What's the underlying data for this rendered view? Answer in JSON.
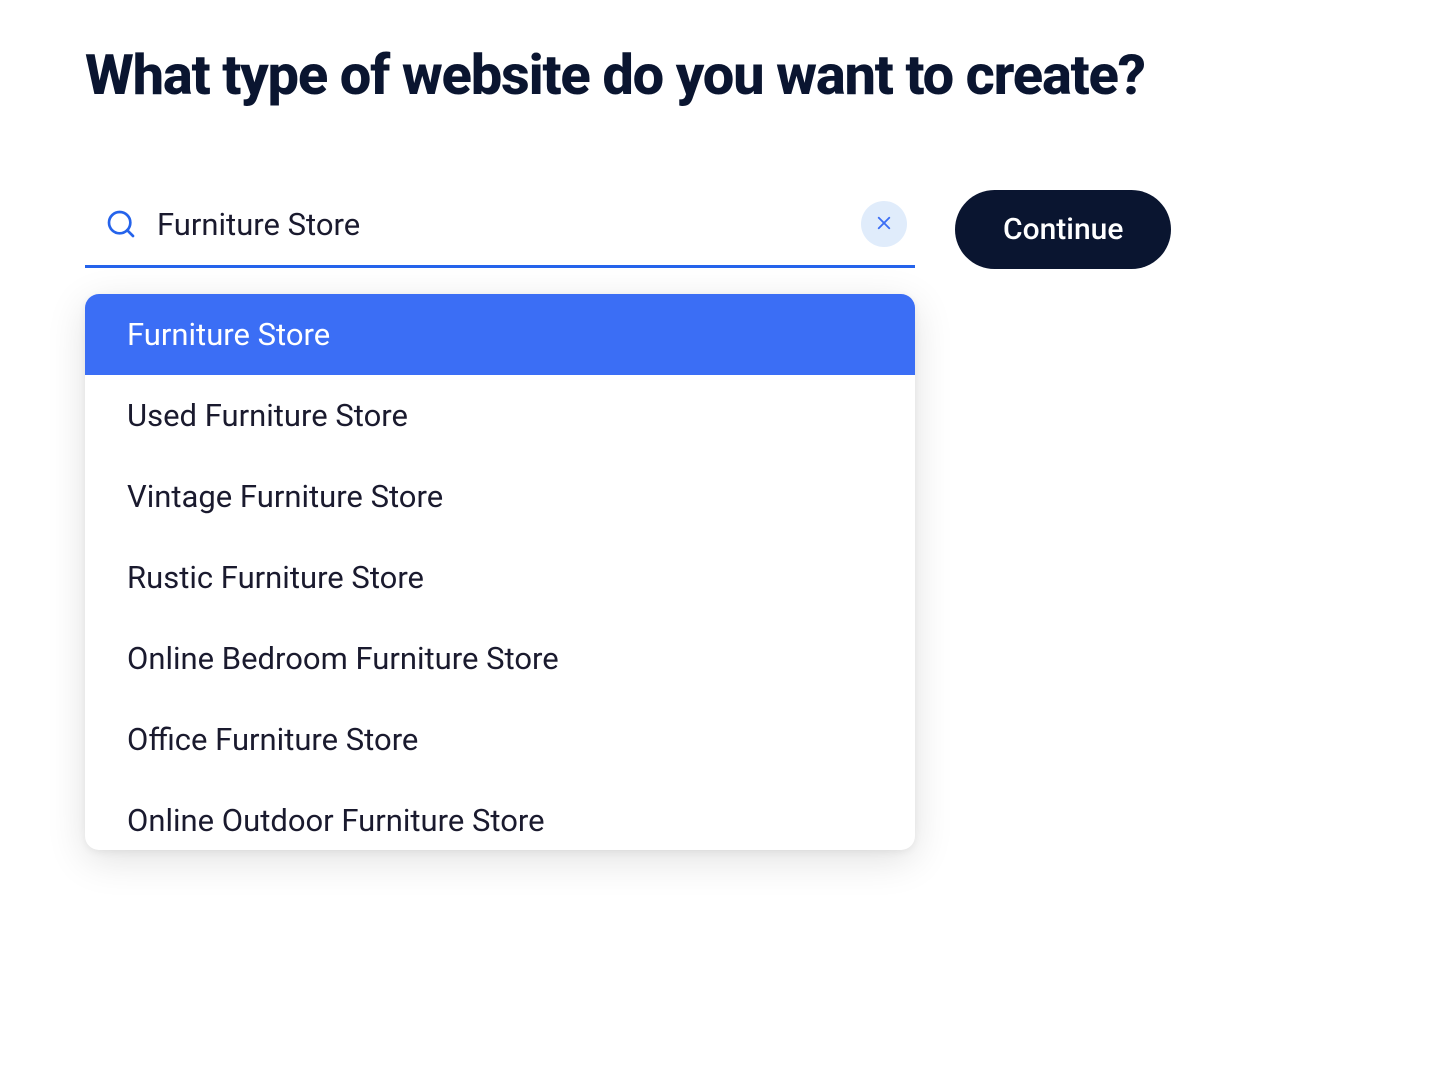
{
  "heading": "What type of website do you want to create?",
  "search": {
    "value": "Furniture Store",
    "placeholder": ""
  },
  "continue_label": "Continue",
  "dropdown": {
    "selected_index": 0,
    "options": [
      "Furniture Store",
      "Used Furniture Store",
      "Vintage Furniture Store",
      "Rustic Furniture Store",
      "Online Bedroom Furniture Store",
      "Office Furniture Store",
      "Online Outdoor Furniture Store"
    ]
  },
  "colors": {
    "accent": "#3b6ef5",
    "accent_underline": "#2563eb",
    "heading": "#0a1530",
    "button_bg": "#0a1530",
    "clear_bg": "#e0ecfb",
    "clear_x": "#3b6ef5",
    "scrollbar_thumb": "#9bb9f0"
  },
  "icons": {
    "search": "search-icon",
    "clear": "close-icon"
  }
}
